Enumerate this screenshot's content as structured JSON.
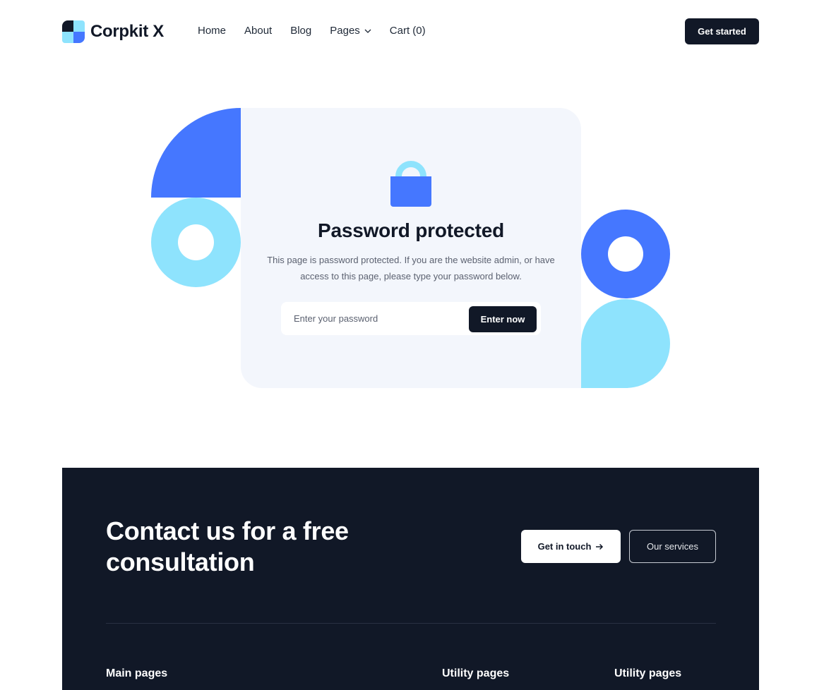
{
  "header": {
    "logo_text": "Corpkit X",
    "nav": [
      {
        "label": "Home"
      },
      {
        "label": "About"
      },
      {
        "label": "Blog"
      },
      {
        "label": "Pages",
        "icon": "chevron-down-icon"
      },
      {
        "label": "Cart (0)"
      }
    ],
    "cta_label": "Get started"
  },
  "hero": {
    "icon": "lock-icon",
    "title": "Password protected",
    "description": "This page is password protected. If you are the website admin, or have access to this page, please type your password below.",
    "password_input": {
      "value": "",
      "placeholder": "Enter your password"
    },
    "submit_label": "Enter now"
  },
  "footer": {
    "cta_title": "Contact us for a free consultation",
    "primary_button": {
      "label": "Get in touch",
      "icon": "arrow-right-icon"
    },
    "secondary_button": {
      "label": "Our services"
    },
    "columns": [
      {
        "heading": "Main pages"
      },
      {
        "heading": "Utility pages"
      },
      {
        "heading": "Utility pages"
      }
    ]
  },
  "colors": {
    "primary_blue": "#4577ff",
    "light_blue": "#8ee3fd",
    "dark_navy": "#111827",
    "card_bg": "#f3f6fc"
  }
}
